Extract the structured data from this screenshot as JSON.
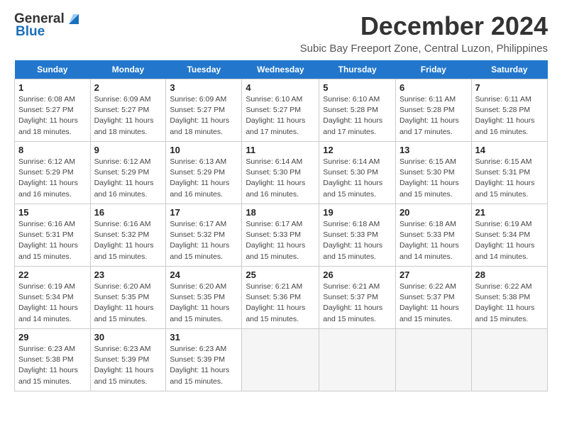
{
  "logo": {
    "general": "General",
    "blue": "Blue"
  },
  "title": "December 2024",
  "subtitle": "Subic Bay Freeport Zone, Central Luzon, Philippines",
  "days_of_week": [
    "Sunday",
    "Monday",
    "Tuesday",
    "Wednesday",
    "Thursday",
    "Friday",
    "Saturday"
  ],
  "weeks": [
    [
      {
        "day": 1,
        "rise": "6:08 AM",
        "set": "5:27 PM",
        "hours": "11 hours and 18 minutes."
      },
      {
        "day": 2,
        "rise": "6:09 AM",
        "set": "5:27 PM",
        "hours": "11 hours and 18 minutes."
      },
      {
        "day": 3,
        "rise": "6:09 AM",
        "set": "5:27 PM",
        "hours": "11 hours and 18 minutes."
      },
      {
        "day": 4,
        "rise": "6:10 AM",
        "set": "5:27 PM",
        "hours": "11 hours and 17 minutes."
      },
      {
        "day": 5,
        "rise": "6:10 AM",
        "set": "5:28 PM",
        "hours": "11 hours and 17 minutes."
      },
      {
        "day": 6,
        "rise": "6:11 AM",
        "set": "5:28 PM",
        "hours": "11 hours and 17 minutes."
      },
      {
        "day": 7,
        "rise": "6:11 AM",
        "set": "5:28 PM",
        "hours": "11 hours and 16 minutes."
      }
    ],
    [
      {
        "day": 8,
        "rise": "6:12 AM",
        "set": "5:29 PM",
        "hours": "11 hours and 16 minutes."
      },
      {
        "day": 9,
        "rise": "6:12 AM",
        "set": "5:29 PM",
        "hours": "11 hours and 16 minutes."
      },
      {
        "day": 10,
        "rise": "6:13 AM",
        "set": "5:29 PM",
        "hours": "11 hours and 16 minutes."
      },
      {
        "day": 11,
        "rise": "6:14 AM",
        "set": "5:30 PM",
        "hours": "11 hours and 16 minutes."
      },
      {
        "day": 12,
        "rise": "6:14 AM",
        "set": "5:30 PM",
        "hours": "11 hours and 15 minutes."
      },
      {
        "day": 13,
        "rise": "6:15 AM",
        "set": "5:30 PM",
        "hours": "11 hours and 15 minutes."
      },
      {
        "day": 14,
        "rise": "6:15 AM",
        "set": "5:31 PM",
        "hours": "11 hours and 15 minutes."
      }
    ],
    [
      {
        "day": 15,
        "rise": "6:16 AM",
        "set": "5:31 PM",
        "hours": "11 hours and 15 minutes."
      },
      {
        "day": 16,
        "rise": "6:16 AM",
        "set": "5:32 PM",
        "hours": "11 hours and 15 minutes."
      },
      {
        "day": 17,
        "rise": "6:17 AM",
        "set": "5:32 PM",
        "hours": "11 hours and 15 minutes."
      },
      {
        "day": 18,
        "rise": "6:17 AM",
        "set": "5:33 PM",
        "hours": "11 hours and 15 minutes."
      },
      {
        "day": 19,
        "rise": "6:18 AM",
        "set": "5:33 PM",
        "hours": "11 hours and 15 minutes."
      },
      {
        "day": 20,
        "rise": "6:18 AM",
        "set": "5:33 PM",
        "hours": "11 hours and 14 minutes."
      },
      {
        "day": 21,
        "rise": "6:19 AM",
        "set": "5:34 PM",
        "hours": "11 hours and 14 minutes."
      }
    ],
    [
      {
        "day": 22,
        "rise": "6:19 AM",
        "set": "5:34 PM",
        "hours": "11 hours and 14 minutes."
      },
      {
        "day": 23,
        "rise": "6:20 AM",
        "set": "5:35 PM",
        "hours": "11 hours and 15 minutes."
      },
      {
        "day": 24,
        "rise": "6:20 AM",
        "set": "5:35 PM",
        "hours": "11 hours and 15 minutes."
      },
      {
        "day": 25,
        "rise": "6:21 AM",
        "set": "5:36 PM",
        "hours": "11 hours and 15 minutes."
      },
      {
        "day": 26,
        "rise": "6:21 AM",
        "set": "5:37 PM",
        "hours": "11 hours and 15 minutes."
      },
      {
        "day": 27,
        "rise": "6:22 AM",
        "set": "5:37 PM",
        "hours": "11 hours and 15 minutes."
      },
      {
        "day": 28,
        "rise": "6:22 AM",
        "set": "5:38 PM",
        "hours": "11 hours and 15 minutes."
      }
    ],
    [
      {
        "day": 29,
        "rise": "6:23 AM",
        "set": "5:38 PM",
        "hours": "11 hours and 15 minutes."
      },
      {
        "day": 30,
        "rise": "6:23 AM",
        "set": "5:39 PM",
        "hours": "11 hours and 15 minutes."
      },
      {
        "day": 31,
        "rise": "6:23 AM",
        "set": "5:39 PM",
        "hours": "11 hours and 15 minutes."
      },
      null,
      null,
      null,
      null
    ]
  ]
}
